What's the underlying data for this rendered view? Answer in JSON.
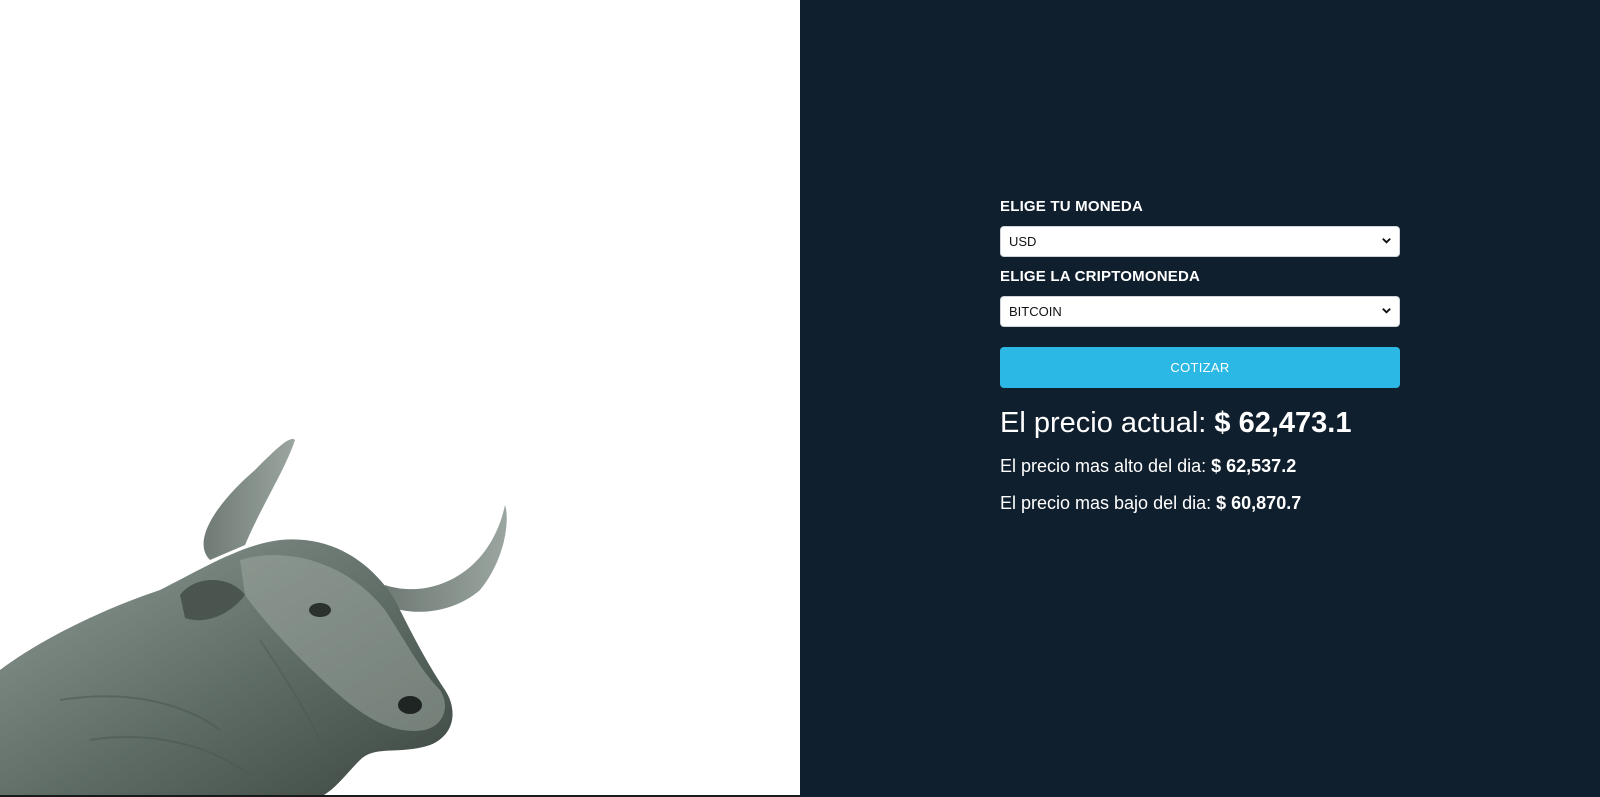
{
  "form": {
    "currency_label": "ELIGE TU MONEDA",
    "currency_selected": "USD",
    "crypto_label": "ELIGE LA CRIPTOMONEDA",
    "crypto_selected": "BITCOIN",
    "submit_label": "COTIZAR"
  },
  "result": {
    "current_label": "El precio actual:",
    "current_value": "$ 62,473.1",
    "high_label": "El precio mas alto del dia:",
    "high_value": "$ 62,537.2",
    "low_label": "El precio mas bajo del dia:",
    "low_value": "$ 60,870.7"
  },
  "colors": {
    "panel_bg": "#101f2e",
    "button_bg": "#2bb8e4",
    "text": "#ffffff"
  },
  "icons": {
    "select_arrow": "chevron-down-icon",
    "hero_image": "bull-image"
  }
}
